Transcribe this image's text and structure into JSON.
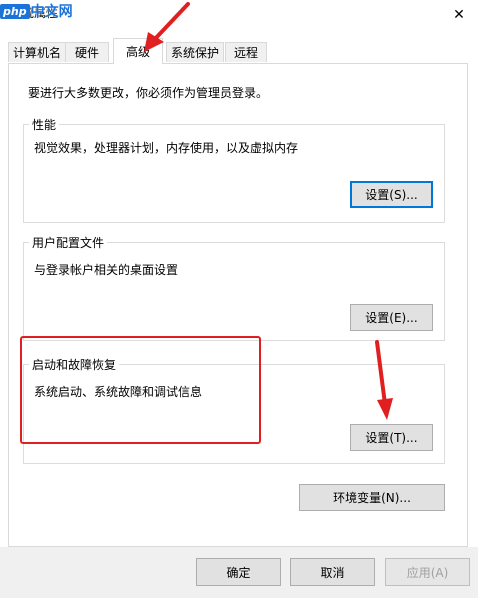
{
  "window": {
    "title": "系统属性",
    "watermark_php": "php",
    "watermark_cn": "中文网",
    "close_glyph": "✕"
  },
  "tabs": [
    {
      "label": "计算机名"
    },
    {
      "label": "硬件"
    },
    {
      "label": "高级"
    },
    {
      "label": "系统保护"
    },
    {
      "label": "远程"
    }
  ],
  "advanced": {
    "admin_note": "要进行大多数更改，你必须作为管理员登录。",
    "performance": {
      "title": "性能",
      "description": "视觉效果，处理器计划，内存使用，以及虚拟内存",
      "button": "设置(S)..."
    },
    "user_profiles": {
      "title": "用户配置文件",
      "description": "与登录帐户相关的桌面设置",
      "button": "设置(E)..."
    },
    "startup_recovery": {
      "title": "启动和故障恢复",
      "description": "系统启动、系统故障和调试信息",
      "button": "设置(T)..."
    },
    "env_button": "环境变量(N)..."
  },
  "footer": {
    "ok": "确定",
    "cancel": "取消",
    "apply": "应用(A)"
  },
  "colors": {
    "annotation": "#e02020",
    "focus": "#0078d7"
  }
}
